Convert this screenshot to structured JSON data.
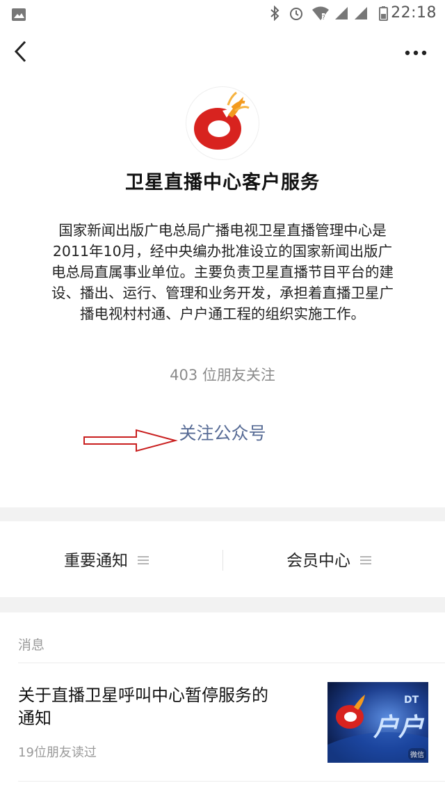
{
  "status_bar": {
    "time": "22:18"
  },
  "profile": {
    "name": "卫星直播中心客户服务",
    "intro": "国家新闻出版广电总局广播电视卫星直播管理中心是2011年10月，经中央编办批准设立的国家新闻出版广电总局直属事业单位。主要负责卫星直播节目平台的建设、播出、运行、管理和业务开发，承担着直播卫星广播电视村村通、户户通工程的组织实施工作。",
    "followers": "403 位朋友关注",
    "follow_label": "关注公众号"
  },
  "menu": {
    "items": [
      {
        "label": "重要通知",
        "icon": "menu-lines-icon"
      },
      {
        "label": "会员中心",
        "icon": "menu-lines-icon"
      }
    ]
  },
  "messages": {
    "section_title": "消息",
    "articles": [
      {
        "title": "关于直播卫星呼叫中心暂停服务的通知",
        "reads": "19位朋友读过",
        "thumb_text": "户户",
        "thumb_text2": "DT",
        "watermark": "微信"
      }
    ]
  },
  "colors": {
    "link": "#576b95",
    "logo_red": "#d8231f",
    "logo_orange": "#f39a1e",
    "annotation_arrow": "#c91e1e"
  }
}
